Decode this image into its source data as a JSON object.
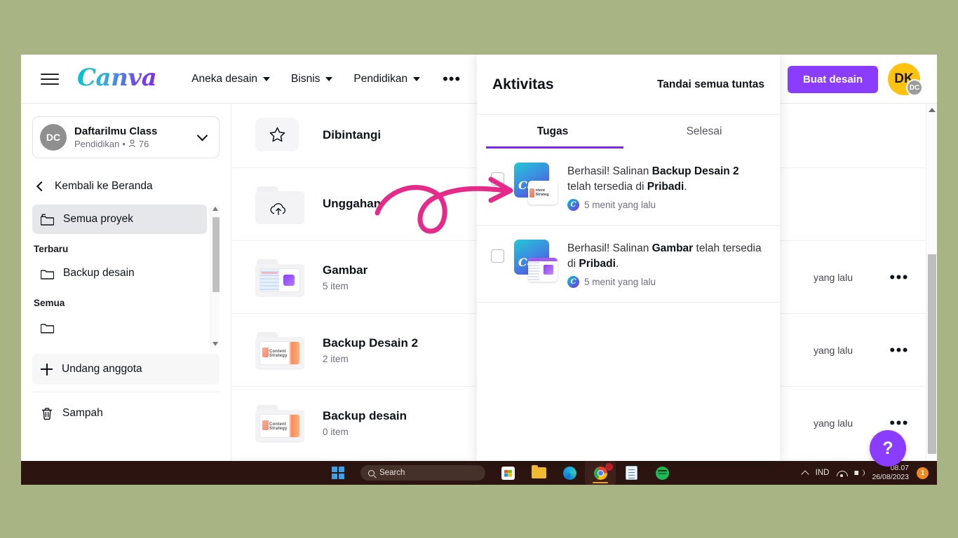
{
  "topbar": {
    "logo_text": "Canva",
    "nav": [
      {
        "label": "Aneka desain",
        "has_caret": true
      },
      {
        "label": "Bisnis",
        "has_caret": true
      },
      {
        "label": "Pendidikan",
        "has_caret": true
      }
    ],
    "more_label": "•••",
    "create_button": "Buat desain",
    "avatar_initials": "DK",
    "avatar_badge": "DC"
  },
  "sidebar": {
    "team": {
      "avatar": "DC",
      "name": "Daftarilmu Class",
      "subtitle_type": "Pendidikan",
      "subtitle_separator": "•",
      "member_count": "76"
    },
    "back_home": "Kembali ke Beranda",
    "items": [
      {
        "label": "Semua proyek",
        "icon": "folder-icon",
        "active": true
      },
      {
        "label": "Terbaru",
        "type": "section"
      },
      {
        "label": "Backup desain",
        "icon": "folder-icon",
        "active": false
      },
      {
        "label": "Semua",
        "type": "section"
      }
    ],
    "invite_member": "Undang anggota",
    "trash": "Sampah"
  },
  "main": {
    "rows": [
      {
        "title": "Dibintangi",
        "sub": "",
        "icon": "star-icon",
        "meta": "",
        "dots": ""
      },
      {
        "title": "Unggahan",
        "sub": "",
        "icon": "upload-cloud-icon",
        "meta": "",
        "dots": ""
      },
      {
        "title": "Gambar",
        "sub": "5 item",
        "icon": "folder-thumb-gambar",
        "meta": "yang lalu",
        "dots": "•••"
      },
      {
        "title": "Backup Desain 2",
        "sub": "2 item",
        "icon": "folder-thumb-strategy",
        "meta": "yang lalu",
        "dots": "•••"
      },
      {
        "title": "Backup desain",
        "sub": "0 item",
        "icon": "folder-thumb-strategy",
        "meta": "yang lalu",
        "dots": "•••"
      }
    ],
    "help_button": "?"
  },
  "activity": {
    "title": "Aktivitas",
    "mark_all": "Tandai semua tuntas",
    "tabs": [
      {
        "label": "Tugas",
        "active": true
      },
      {
        "label": "Selesai",
        "active": false
      }
    ],
    "notifications": [
      {
        "prefix": "Berhasil! Salinan ",
        "subject": "Backup Desain 2",
        "middle": " telah tersedia di ",
        "location": "Pribadi",
        "suffix": ".",
        "time": "5 menit yang lalu",
        "checked": false,
        "overlay": "strategy",
        "overlay_text": "ntent Strateg"
      },
      {
        "prefix": "Berhasil! Salinan ",
        "subject": "Gambar",
        "middle": " telah tersedia di ",
        "location": "Pribadi",
        "suffix": ".",
        "time": "5 menit yang lalu",
        "checked": false,
        "overlay": "editor",
        "overlay_text": ""
      }
    ]
  },
  "taskbar": {
    "search_placeholder": "Search",
    "apps": [
      "microsoft-store-icon",
      "file-explorer-icon",
      "edge-icon",
      "chrome-icon",
      "notepad-icon",
      "spotify-icon"
    ],
    "language": "IND",
    "time": "08.07",
    "date": "26/08/2023",
    "notification_count": "1"
  },
  "annotation": {
    "type": "hand-drawn-arrow",
    "color": "#e52a8a"
  },
  "colors": {
    "desktop_background": "#a8b484",
    "brand_purple": "#8b3dff",
    "accent_purple": "#7d2ae8",
    "avatar_yellow": "#ffc20e",
    "taskbar": "#2c1510",
    "annotation_pink": "#e52a8a"
  }
}
